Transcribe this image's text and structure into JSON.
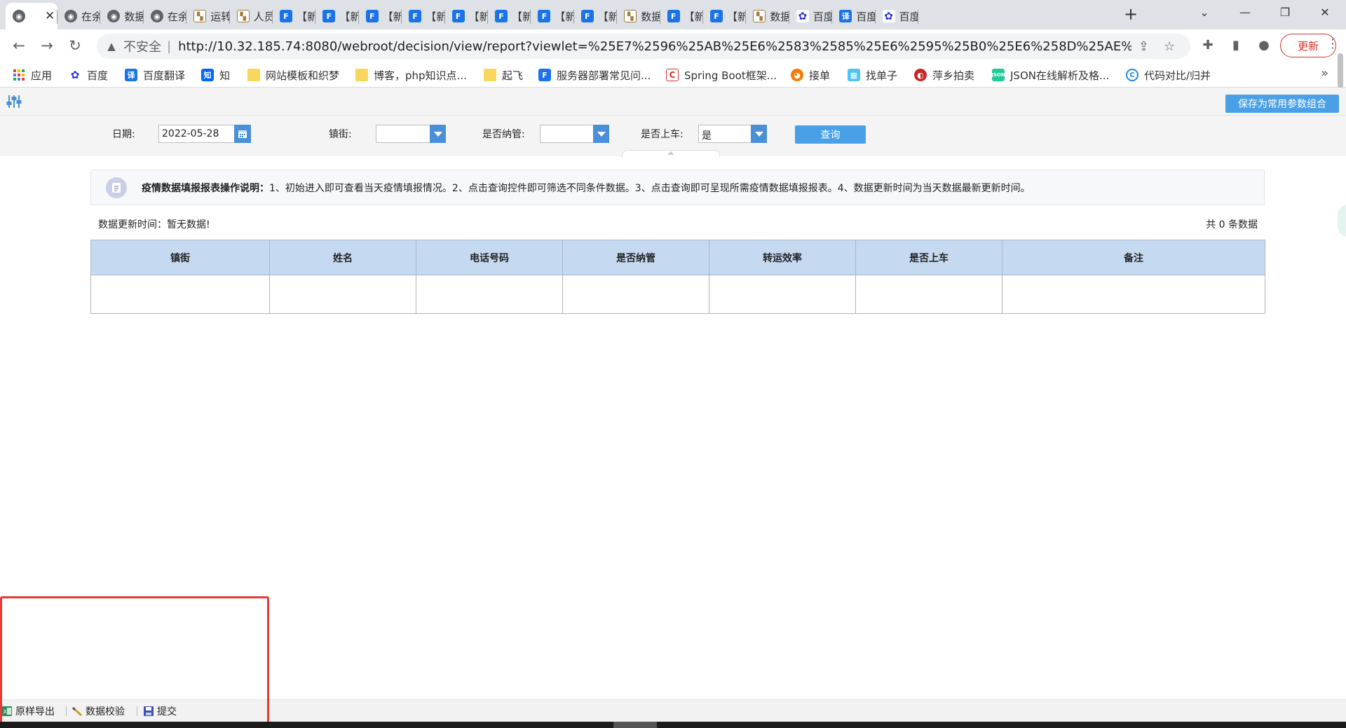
{
  "browser": {
    "tabs": [
      {
        "icon": "globe",
        "title": ""
      },
      {
        "icon": "globe",
        "title": "在余"
      },
      {
        "icon": "globe",
        "title": "数据"
      },
      {
        "icon": "globe",
        "title": "在余"
      },
      {
        "icon": "image",
        "title": "运转"
      },
      {
        "icon": "image",
        "title": "人员"
      },
      {
        "icon": "fr",
        "title": "【新"
      },
      {
        "icon": "fr",
        "title": "【新"
      },
      {
        "icon": "fr",
        "title": "【新"
      },
      {
        "icon": "fr",
        "title": "【新"
      },
      {
        "icon": "fr",
        "title": "【新"
      },
      {
        "icon": "fr",
        "title": "【新"
      },
      {
        "icon": "fr",
        "title": "【新"
      },
      {
        "icon": "fr",
        "title": "【新"
      },
      {
        "icon": "image",
        "title": "数据"
      },
      {
        "icon": "fr",
        "title": "【新"
      },
      {
        "icon": "fr",
        "title": "【新"
      },
      {
        "icon": "image",
        "title": "数据"
      },
      {
        "icon": "baidu",
        "title": "百度"
      },
      {
        "icon": "yi",
        "title": "百度"
      },
      {
        "icon": "baidu",
        "title": "百度"
      }
    ],
    "new_tab": "+",
    "window_controls": {
      "dropdown": "⌄",
      "minimize": "—",
      "restore": "❐",
      "close": "✕"
    },
    "nav": {
      "back": "←",
      "forward": "→",
      "reload": "↻"
    },
    "address": {
      "security_label": "不安全",
      "separator": "|",
      "url": "http://10.32.185.74:8080/webroot/decision/view/report?viewlet=%25E7%2596%25AB%25E6%2583%2585%25E6%2595%25B0%25E6%258D%25AE%25E5%25A1..."
    },
    "update_label": "更新",
    "bookmarks": [
      {
        "icon": "apps",
        "label": "应用"
      },
      {
        "icon": "baidu",
        "label": "百度"
      },
      {
        "icon": "yi",
        "label": "百度翻译"
      },
      {
        "icon": "zhi",
        "label": "知"
      },
      {
        "icon": "folder",
        "label": "网站模板和织梦"
      },
      {
        "icon": "folder",
        "label": "博客，php知识点..."
      },
      {
        "icon": "folder",
        "label": "起飞"
      },
      {
        "icon": "fr",
        "label": "服务器部署常见问..."
      },
      {
        "icon": "c",
        "label": "Spring Boot框架..."
      },
      {
        "icon": "jd",
        "label": "接单"
      },
      {
        "icon": "zd",
        "label": "找单子"
      },
      {
        "icon": "px",
        "label": "萍乡拍卖"
      },
      {
        "icon": "json",
        "label": "JSON在线解析及格..."
      },
      {
        "icon": "cmp",
        "label": "代码对比/归并"
      }
    ],
    "bookmarks_more": "»"
  },
  "report": {
    "save_combo_label": "保存为常用参数组合",
    "params": {
      "date_label": "日期:",
      "date_value": "2022-05-28",
      "street_label": "镇街:",
      "street_value": "",
      "managed_label": "是否纳管:",
      "managed_value": "",
      "boarded_label": "是否上车:",
      "boarded_value": "是",
      "query_label": "查询"
    },
    "notice": {
      "title": "疫情数据填报报表操作说明：",
      "body": "1、初始进入即可查看当天疫情填报情况。2、点击查询控件即可筛选不同条件数据。3、点击查询即可呈现所需疫情数据填报报表。4、数据更新时间为当天数据最新更新时间。"
    },
    "update_time": "数据更新时间：暂无数据!",
    "count": "共 0 条数据",
    "columns": [
      "镇街",
      "姓名",
      "电话号码",
      "是否纳管",
      "转运效率",
      "是否上车",
      "备注"
    ],
    "rows": [
      [
        "",
        "",
        "",
        "",
        "",
        "",
        ""
      ]
    ],
    "toolbar": {
      "export_label": "原样导出",
      "verify_label": "数据校验",
      "submit_label": "提交"
    }
  },
  "colors": {
    "accent": "#4aa0e6",
    "header_bg": "#c5d9f1",
    "highlight_frame": "#e53935"
  }
}
